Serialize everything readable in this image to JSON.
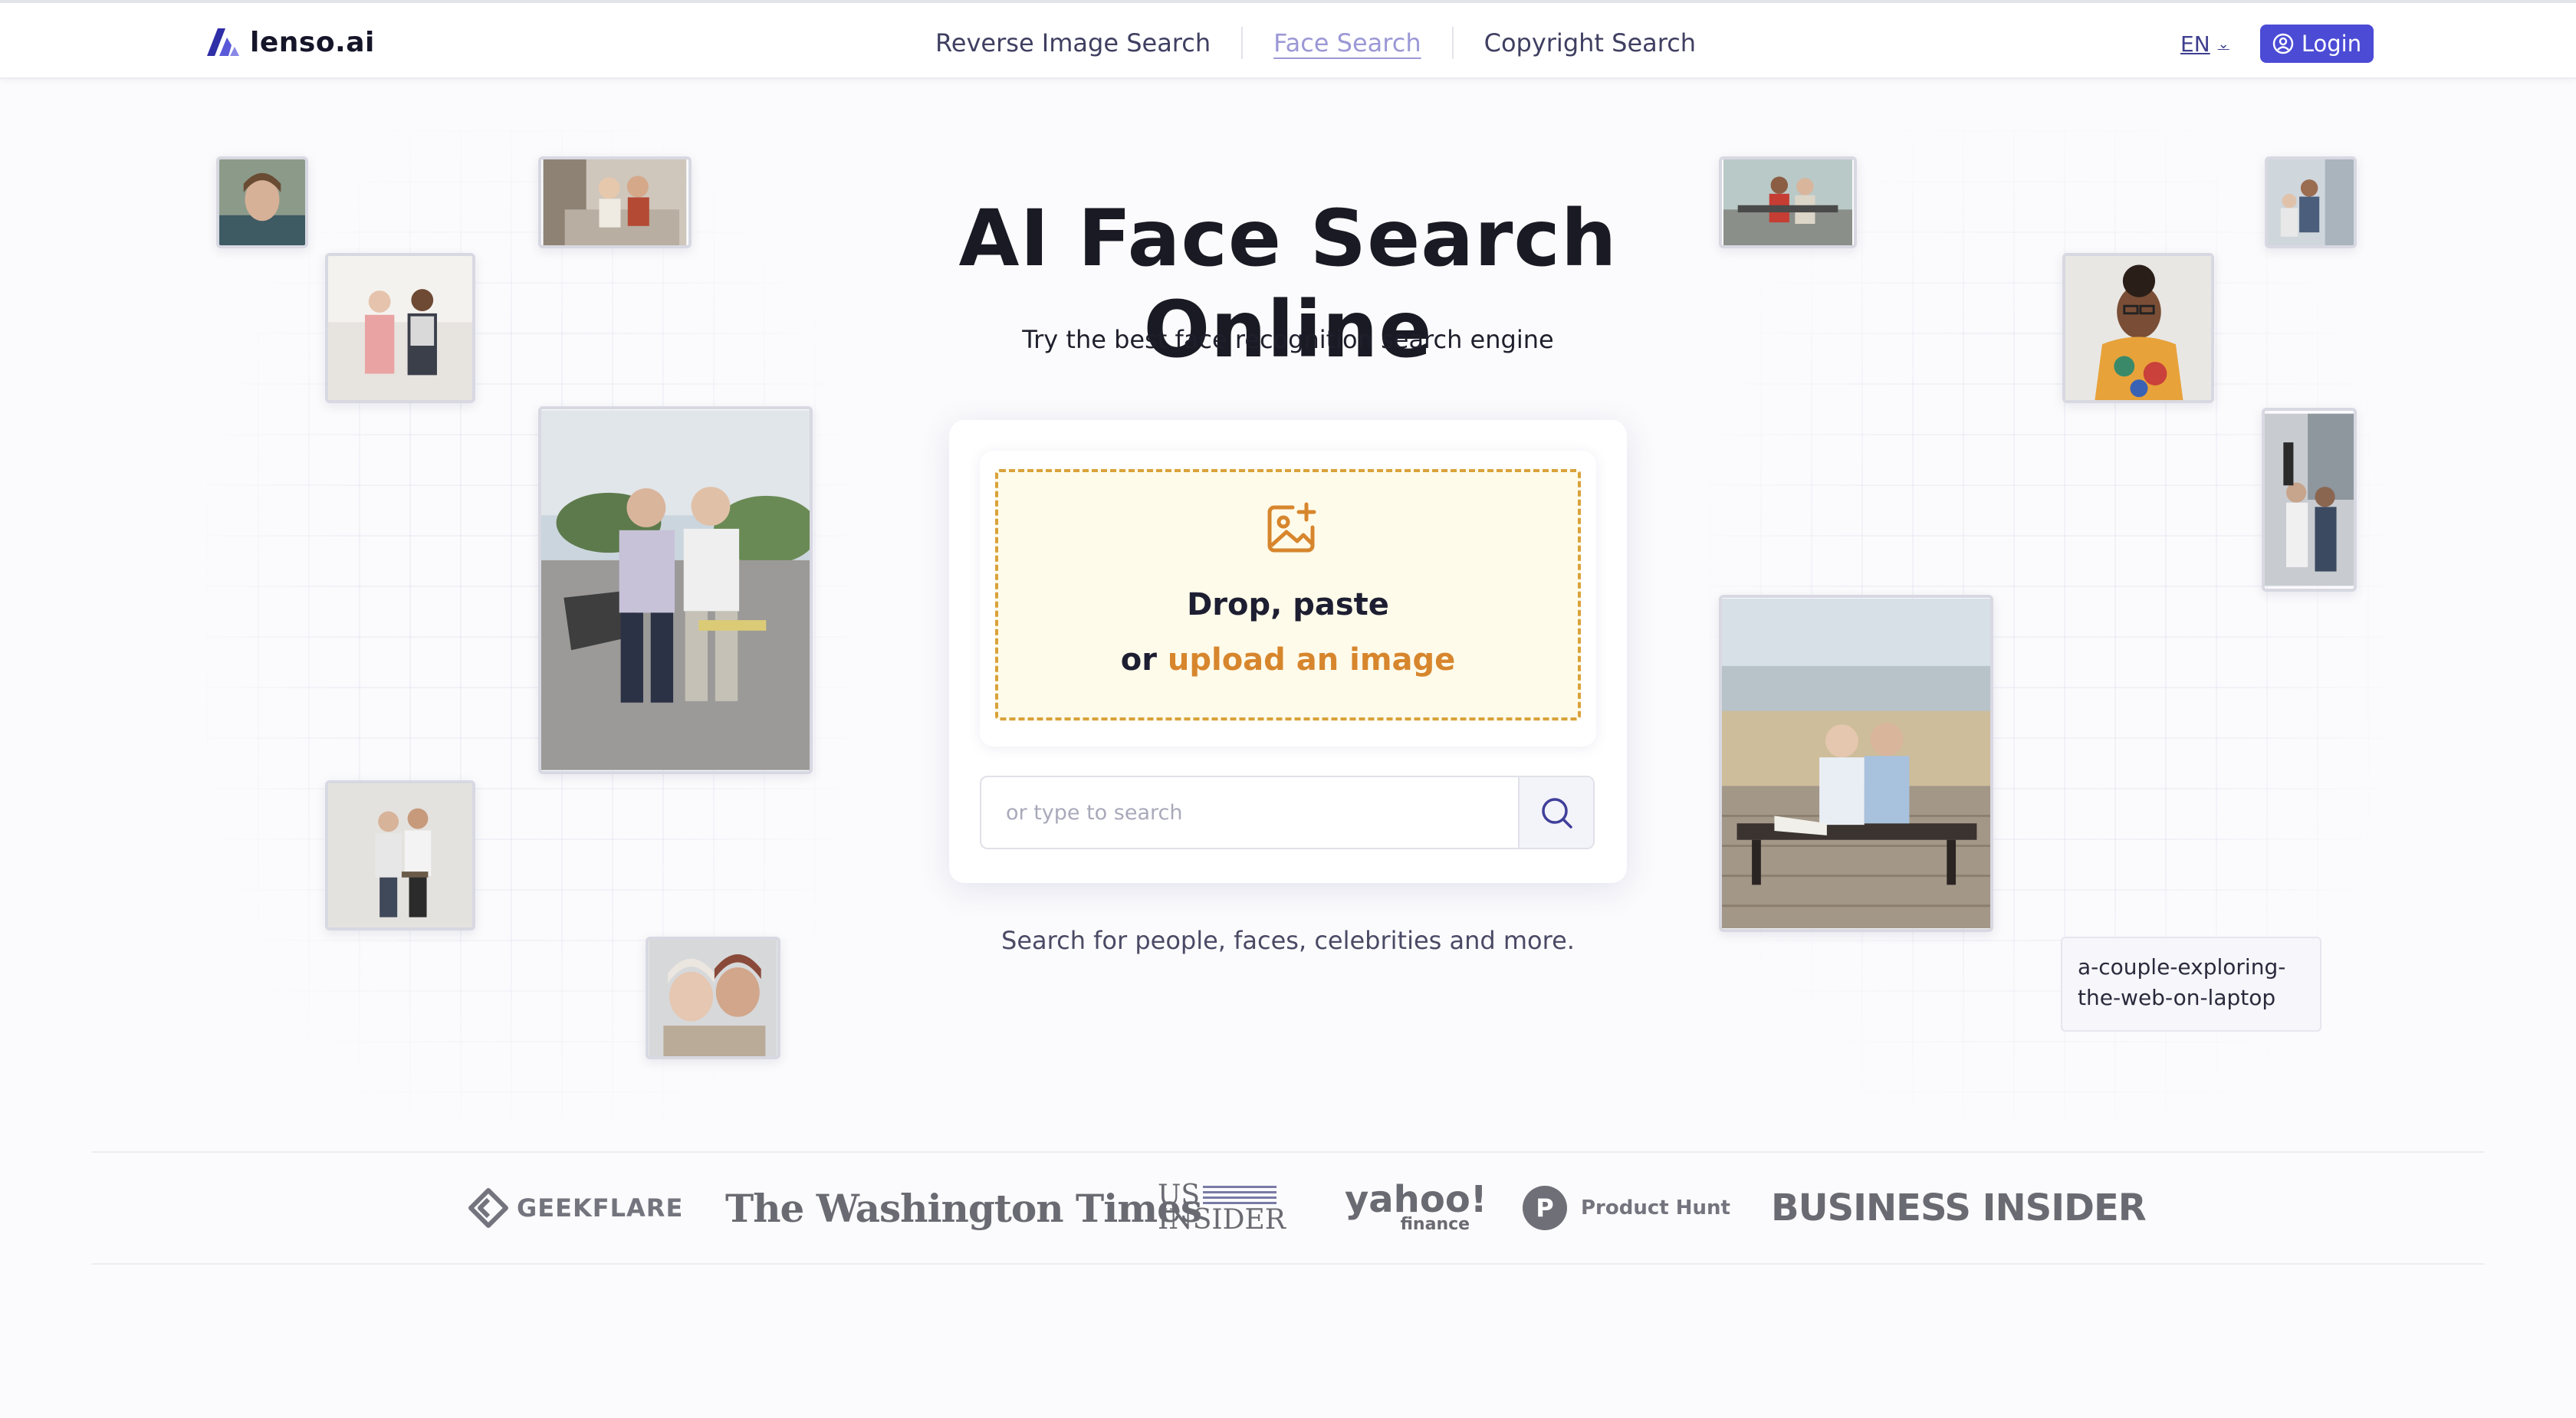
{
  "header": {
    "logo_text": "lenso.ai",
    "nav": [
      {
        "label": "Reverse Image Search",
        "active": false
      },
      {
        "label": "Face Search",
        "active": true
      },
      {
        "label": "Copyright Search",
        "active": false
      }
    ],
    "language": "EN",
    "login_label": "Login"
  },
  "hero": {
    "title": "AI Face Search Online",
    "subtitle": "Try the best face recognition search engine",
    "drop_line1": "Drop, paste",
    "drop_or": "or",
    "drop_link": "upload an image",
    "search_placeholder": "or type to search",
    "note": "Search for people, faces, celebrities and more.",
    "caption": "a-couple-exploring-the-web-on-laptop"
  },
  "press": {
    "geekflare": "GEEKFLARE",
    "washington_times": "The Washington Times",
    "us_insider_top": "US",
    "us_insider_bottom": "INSIDER",
    "yahoo": "yahoo!",
    "yahoo_sub": "finance",
    "product_hunt_mark": "P",
    "product_hunt": "Product Hunt",
    "business_insider": "BUSINESS INSIDER"
  },
  "colors": {
    "brand": "#4b4bd6",
    "accent_orange": "#d7862d",
    "dropzone_bg": "#fffbea",
    "nav_active": "#9b98d6"
  },
  "icons": {
    "logo": "lenso-logo-icon",
    "login": "user-circle-icon",
    "upload": "image-plus-icon",
    "search": "search-icon",
    "language": "chevron-down-icon"
  }
}
